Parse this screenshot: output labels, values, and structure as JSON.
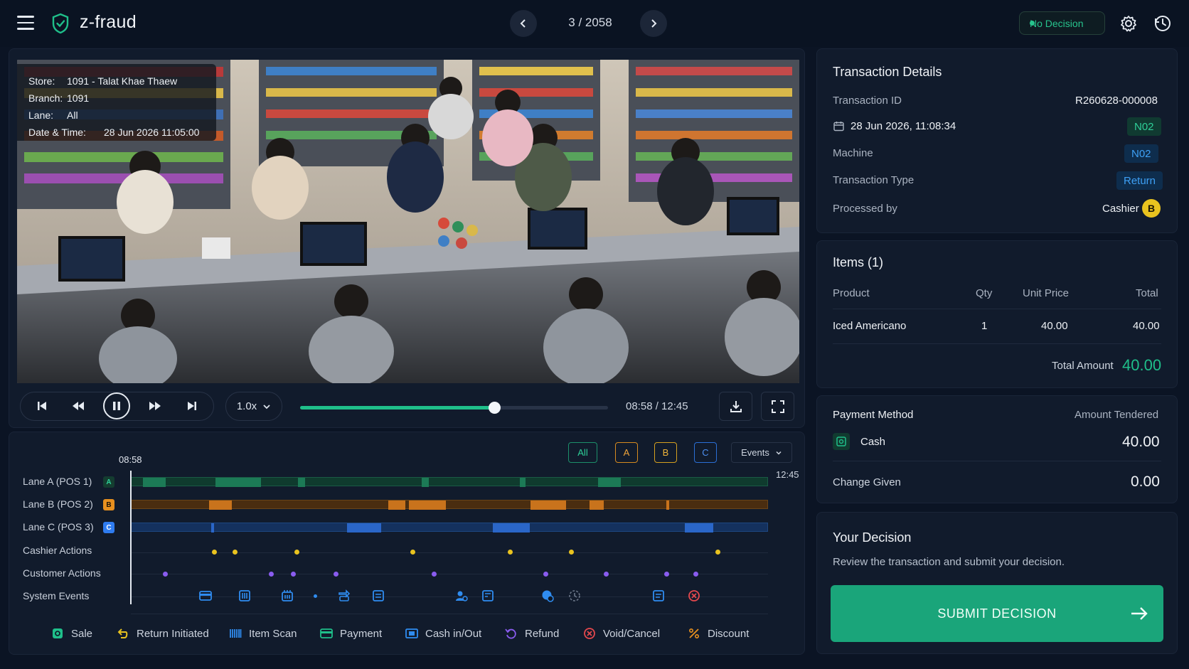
{
  "app": {
    "brand": "z-fraud",
    "counter": "3 / 2058",
    "status_badge": "No Decision"
  },
  "video": {
    "store_label": "Store:",
    "store": "1091 - Talat Khae Thaew",
    "branch_label": "Branch:",
    "branch": "1091",
    "lane_label": "Lane:",
    "lane": "All",
    "datetime_label": "Date & Time:",
    "datetime": "28 Jun 2026 11:05:00"
  },
  "player": {
    "speed": "1.0x",
    "current_time": "08:58",
    "total_time": "12:45",
    "time_display": "08:58 / 12:45",
    "progress": 0.63
  },
  "timeline": {
    "filters": [
      "All",
      "A",
      "B",
      "C"
    ],
    "events_dropdown": "Events",
    "cursor_time": "08:58",
    "end_time": "12:45",
    "rows": [
      {
        "label": "Lane A (POS 1)",
        "badge": "A",
        "color": "#1fbf8a"
      },
      {
        "label": "Lane B (POS 2)",
        "badge": "B",
        "color": "#e8901f"
      },
      {
        "label": "Lane C (POS 3)",
        "badge": "C",
        "color": "#2f7cf0"
      },
      {
        "label": "Cashier Actions"
      },
      {
        "label": "Customer Actions"
      },
      {
        "label": "System Events"
      }
    ],
    "legend": [
      "Sale",
      "Return Initiated",
      "Item Scan",
      "Payment",
      "Cash in/Out",
      "Refund",
      "Void/Cancel",
      "Discount"
    ]
  },
  "transaction": {
    "title": "Transaction Details",
    "id_label": "Transaction ID",
    "id": "R260628-000008",
    "date": "28 Jun 2026, 11:08:34",
    "date_tag": "N02",
    "machine_label": "Machine",
    "machine": "N02",
    "type_label": "Transaction Type",
    "type": "Return",
    "processed_label": "Processed by",
    "processed_by": "Cashier",
    "processed_badge": "B"
  },
  "items": {
    "title": "Items (1)",
    "columns": [
      "Product",
      "Qty",
      "Unit Price",
      "Total"
    ],
    "rows": [
      {
        "product": "Iced Americano",
        "qty": "1",
        "unit_price": "40.00",
        "total": "40.00"
      }
    ],
    "total_label": "Total Amount",
    "total_amount": "40.00"
  },
  "payment": {
    "method_label": "Payment Method",
    "tendered_label": "Amount Tendered",
    "method": "Cash",
    "tendered": "40.00",
    "change_label": "Change Given",
    "change": "0.00"
  },
  "decision": {
    "title": "Your Decision",
    "subtitle": "Review the transaction and submit your decision.",
    "submit_label": "SUBMIT DECISION"
  }
}
